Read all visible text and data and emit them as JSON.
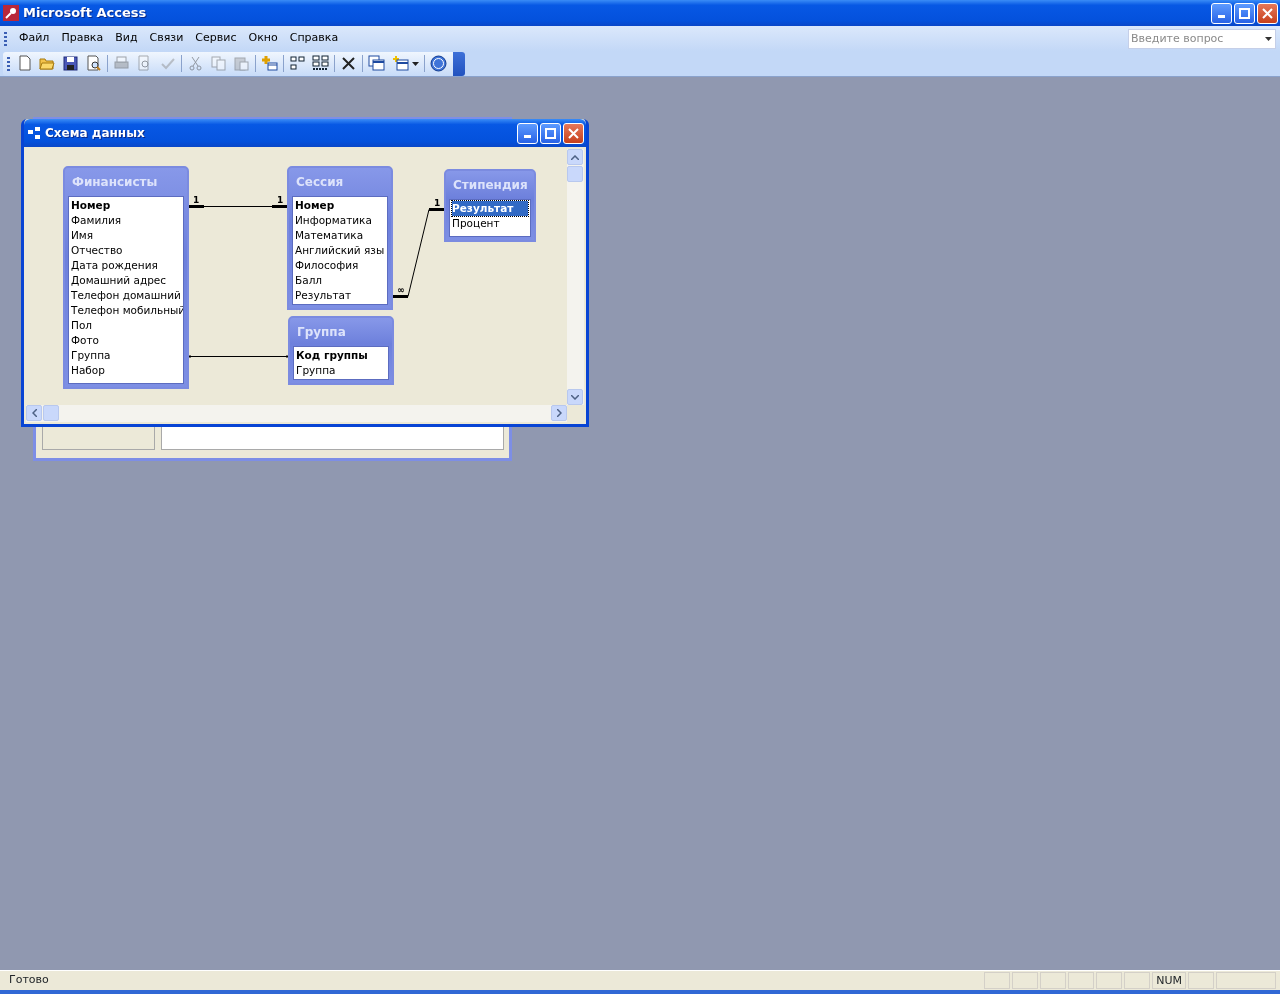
{
  "window": {
    "title": "Microsoft Access"
  },
  "menu": [
    {
      "label": "Файл"
    },
    {
      "label": "Правка"
    },
    {
      "label": "Вид"
    },
    {
      "label": "Связи"
    },
    {
      "label": "Сервис"
    },
    {
      "label": "Окно"
    },
    {
      "label": "Справка"
    }
  ],
  "question_box": {
    "placeholder": "Введите вопрос"
  },
  "toolbar": [
    {
      "kind": "new",
      "disabled": false
    },
    {
      "kind": "open",
      "disabled": false
    },
    {
      "kind": "save",
      "disabled": false
    },
    {
      "kind": "search",
      "disabled": false
    },
    {
      "kind": "separator"
    },
    {
      "kind": "print",
      "disabled": true
    },
    {
      "kind": "preview",
      "disabled": true
    },
    {
      "kind": "spelling",
      "disabled": true
    },
    {
      "kind": "separator"
    },
    {
      "kind": "cut",
      "disabled": true
    },
    {
      "kind": "copy",
      "disabled": true
    },
    {
      "kind": "paste",
      "disabled": true
    },
    {
      "kind": "separator"
    },
    {
      "kind": "add-table",
      "disabled": false
    },
    {
      "kind": "separator"
    },
    {
      "kind": "direct",
      "disabled": false
    },
    {
      "kind": "all",
      "disabled": false
    },
    {
      "kind": "separator"
    },
    {
      "kind": "delete",
      "disabled": false
    },
    {
      "kind": "separator"
    },
    {
      "kind": "windows",
      "disabled": false
    },
    {
      "kind": "new-object",
      "disabled": false,
      "has_menu": true
    },
    {
      "kind": "separator"
    },
    {
      "kind": "help",
      "disabled": false
    }
  ],
  "relationships_window": {
    "title": "Схема данных",
    "tables": [
      {
        "title": "Финансисты",
        "fields": [
          {
            "name": "Номер",
            "primary_key": true,
            "selected": false
          },
          {
            "name": "Фамилия",
            "primary_key": false,
            "selected": false
          },
          {
            "name": "Имя",
            "primary_key": false,
            "selected": false
          },
          {
            "name": "Отчество",
            "primary_key": false,
            "selected": false
          },
          {
            "name": "Дата рождения",
            "primary_key": false,
            "selected": false
          },
          {
            "name": "Домашний адрес",
            "primary_key": false,
            "selected": false
          },
          {
            "name": "Телефон домашний",
            "primary_key": false,
            "selected": false
          },
          {
            "name": "Телефон мобильный",
            "primary_key": false,
            "selected": false
          },
          {
            "name": "Пол",
            "primary_key": false,
            "selected": false
          },
          {
            "name": "Фото",
            "primary_key": false,
            "selected": false
          },
          {
            "name": "Группа",
            "primary_key": false,
            "selected": false
          },
          {
            "name": "Набор",
            "primary_key": false,
            "selected": false
          }
        ]
      },
      {
        "title": "Сессия",
        "fields": [
          {
            "name": "Номер",
            "primary_key": true,
            "selected": false
          },
          {
            "name": "Информатика",
            "primary_key": false,
            "selected": false
          },
          {
            "name": "Математика",
            "primary_key": false,
            "selected": false
          },
          {
            "name": "Английский язы",
            "primary_key": false,
            "selected": false
          },
          {
            "name": "Философия",
            "primary_key": false,
            "selected": false
          },
          {
            "name": "Балл",
            "primary_key": false,
            "selected": false
          },
          {
            "name": "Результат",
            "primary_key": false,
            "selected": false
          }
        ]
      },
      {
        "title": "Стипендия",
        "fields": [
          {
            "name": "Результат",
            "primary_key": true,
            "selected": true
          },
          {
            "name": "Процент",
            "primary_key": false,
            "selected": false
          }
        ]
      },
      {
        "title": "Группа",
        "fields": [
          {
            "name": "Код группы",
            "primary_key": true,
            "selected": false
          },
          {
            "name": "Группа",
            "primary_key": false,
            "selected": false
          }
        ]
      }
    ],
    "relationships": [
      {
        "kind": "enforced",
        "start_label": "1",
        "end_label": "1"
      },
      {
        "kind": "enforced",
        "start_label": "∞",
        "end_label": "1"
      },
      {
        "kind": "plain"
      }
    ]
  },
  "status_bar": {
    "text": "Готово",
    "indicators": [
      "NUM"
    ]
  }
}
